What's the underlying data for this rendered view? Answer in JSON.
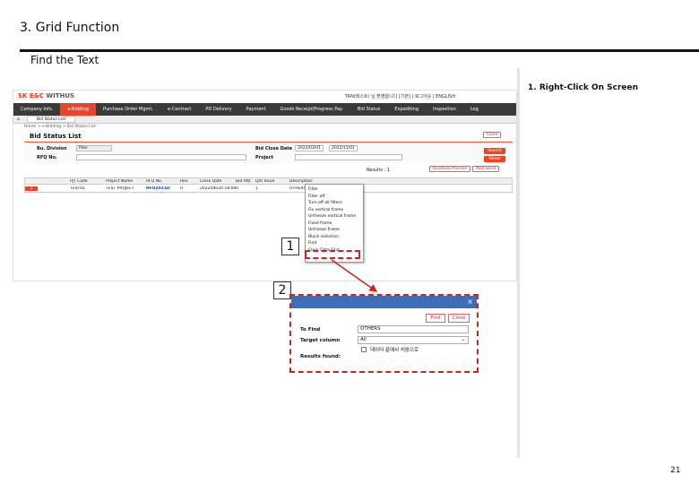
{
  "slide": {
    "title": "3. Grid Function",
    "subtitle": "Find the Text",
    "step_label": "1. Right-Click On Screen",
    "page_number": "21"
  },
  "screenshot": {
    "logo_main": "SK E&C",
    "logo_sub": "WITHUS",
    "user_info": "TAN(테스트) 님 환영합니다 [기본] | 로그아웃 | ENGLISH",
    "menu": [
      "Company Info.",
      "e-Bidding",
      "Purchase Order Mgmt.",
      "e-Contract",
      "PO Delivery",
      "Payment",
      "Goods Receipt/Progress Pay.",
      "Bid Status",
      "Expediting",
      "Inspection",
      "Log"
    ],
    "active_menu": "e-Bidding",
    "tabs": [
      "Bid Status List"
    ],
    "breadcrumb": "Home > e-Bidding > Bid Status List",
    "page_title": "Bid Status List",
    "form": {
      "bu_label": "Bu. Division",
      "bu_value": "Plan",
      "rfq_label": "RFQ No.",
      "close_label": "Bid Close Date",
      "close_from": "2022/03/01",
      "close_to": "2022/11/01",
      "project_label": "Project",
      "btn_close": "Close",
      "btn_search": "Search",
      "btn_reset": "Reset"
    },
    "results_label": "Results : 1",
    "btn_question": "Question Process",
    "btn_mail": "Mail Send",
    "columns": [
      "PJT Code",
      "Project Name",
      "RFQ No.",
      "Rev.",
      "Close Date",
      "Bid Attr.",
      "Q/R Issue",
      "Description"
    ],
    "row": {
      "index": "1",
      "code": "TEST01",
      "name": "TEST PROJECT",
      "rfq": "RFQ2021D",
      "rev": "0",
      "close": "2022/06/20 18:00",
      "attr": "0",
      "issue": "1",
      "desc": "OTHERS"
    },
    "context_menu": [
      "Filter",
      "Filter off",
      "Turn off all filters",
      "Fix vertical frame",
      "Unfreeze vertical frame",
      "Fixed frame",
      "Unfreeze frame",
      "Block selection",
      "Find",
      "Clear Data Find"
    ]
  },
  "callouts": {
    "one": "1",
    "two": "2"
  },
  "find_dialog": {
    "close_glyph": "×",
    "btn_find": "Find",
    "btn_close": "Close",
    "to_find_label": "To Find",
    "to_find_value": "OTHERS",
    "target_label": "Target column",
    "target_value": "All",
    "checkbox_label": "데이터 끝에서 처음으로",
    "results_label": "Results found:"
  }
}
